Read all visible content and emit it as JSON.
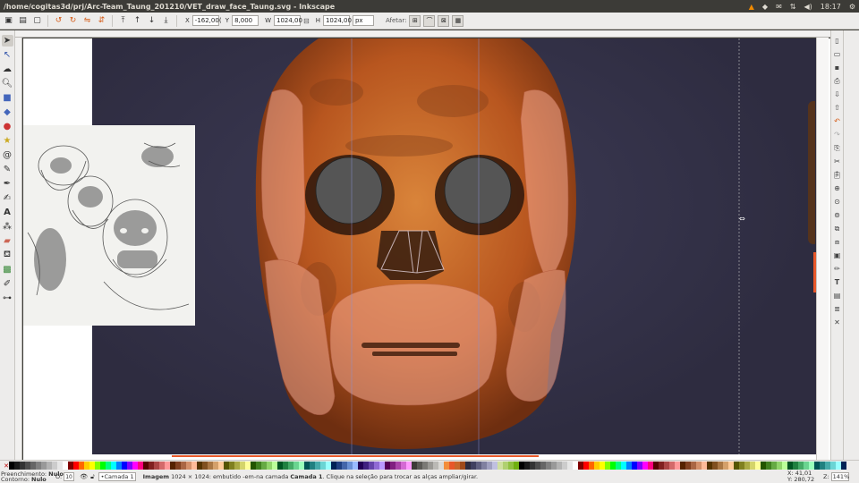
{
  "window": {
    "title": "/home/cogitas3d/prj/Arc-Team_Taung_201210/VET_draw_face_Taung.svg - Inkscape",
    "clock": "18:17"
  },
  "controls": {
    "x_label": "X",
    "x_value": "-162,00(",
    "y_label": "Y",
    "y_value": "8,000",
    "w_label": "W",
    "w_value": "1024,00",
    "h_label": "H",
    "h_value": "1024,00",
    "unit": "px",
    "afetar_label": "Afetar:"
  },
  "status": {
    "fill_label": "Preenchimento:",
    "fill_value": "Nulo",
    "stroke_label": "Contorno:",
    "stroke_value": "Nulo",
    "opacity_label": "O:",
    "opacity_value": "10",
    "layer": "•Camada 1",
    "message_bold": "Imagem",
    "message_mid": " 1024 × 1024: embutido -em-na camada ",
    "message_layer": "Camada 1",
    "message_tail": ". Clique na seleção para trocar as alças ampliar/girar.",
    "x_coord": "X:  41,01",
    "y_coord": "Y: 280,72",
    "zoom_label": "Z:",
    "zoom_value": "141%"
  },
  "colors": {
    "accent": "#e8582a",
    "canvas_bg": "#302e44",
    "skull_orange": "#c8672a",
    "overlay_pink": "#f0a08c",
    "eye_gray": "#555555"
  }
}
